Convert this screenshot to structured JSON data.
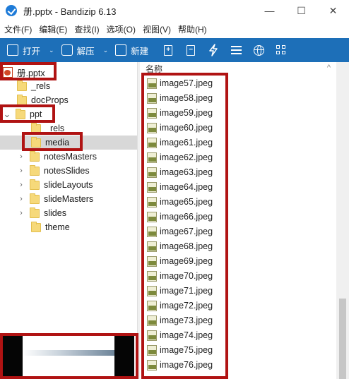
{
  "window": {
    "title": "册.pptx - Bandizip 6.13",
    "minimize_symbol": "—",
    "maximize_symbol": "☐",
    "close_symbol": "✕"
  },
  "menu": [
    "文件(F)",
    "编辑(E)",
    "查找(I)",
    "选项(O)",
    "视图(V)",
    "帮助(H)"
  ],
  "toolbar": {
    "open_label": "打开",
    "extract_label": "解压",
    "new_label": "新建",
    "caret": "⌄",
    "icons": [
      "add-file-icon",
      "remove-file-icon",
      "lightning-icon",
      "list-view-icon",
      "globe-icon",
      "grid-view-icon"
    ]
  },
  "tree": {
    "root": "册.pptx",
    "items": [
      {
        "label": "_rels",
        "level": 1,
        "expander": ""
      },
      {
        "label": "docProps",
        "level": 1,
        "expander": ""
      },
      {
        "label": "ppt",
        "level": 1,
        "expander": "⌄"
      },
      {
        "label": "_rels",
        "level": 2,
        "expander": ""
      },
      {
        "label": "media",
        "level": 2,
        "expander": "",
        "selected": true
      },
      {
        "label": "notesMasters",
        "level": 2,
        "expander": "›"
      },
      {
        "label": "notesSlides",
        "level": 2,
        "expander": "›"
      },
      {
        "label": "slideLayouts",
        "level": 2,
        "expander": "›"
      },
      {
        "label": "slideMasters",
        "level": 2,
        "expander": "›"
      },
      {
        "label": "slides",
        "level": 2,
        "expander": "›"
      },
      {
        "label": "theme",
        "level": 2,
        "expander": ""
      }
    ]
  },
  "list": {
    "header": "名称",
    "sort_caret": "^",
    "files": [
      "image57.jpeg",
      "image58.jpeg",
      "image59.jpeg",
      "image60.jpeg",
      "image61.jpeg",
      "image62.jpeg",
      "image63.jpeg",
      "image64.jpeg",
      "image65.jpeg",
      "image66.jpeg",
      "image67.jpeg",
      "image68.jpeg",
      "image69.jpeg",
      "image70.jpeg",
      "image71.jpeg",
      "image72.jpeg",
      "image73.jpeg",
      "image74.jpeg",
      "image75.jpeg",
      "image76.jpeg"
    ]
  },
  "colors": {
    "toolbar_bg": "#1d6fb8",
    "annotation_red": "#b01313",
    "selection_bg": "#d8d8d8"
  }
}
